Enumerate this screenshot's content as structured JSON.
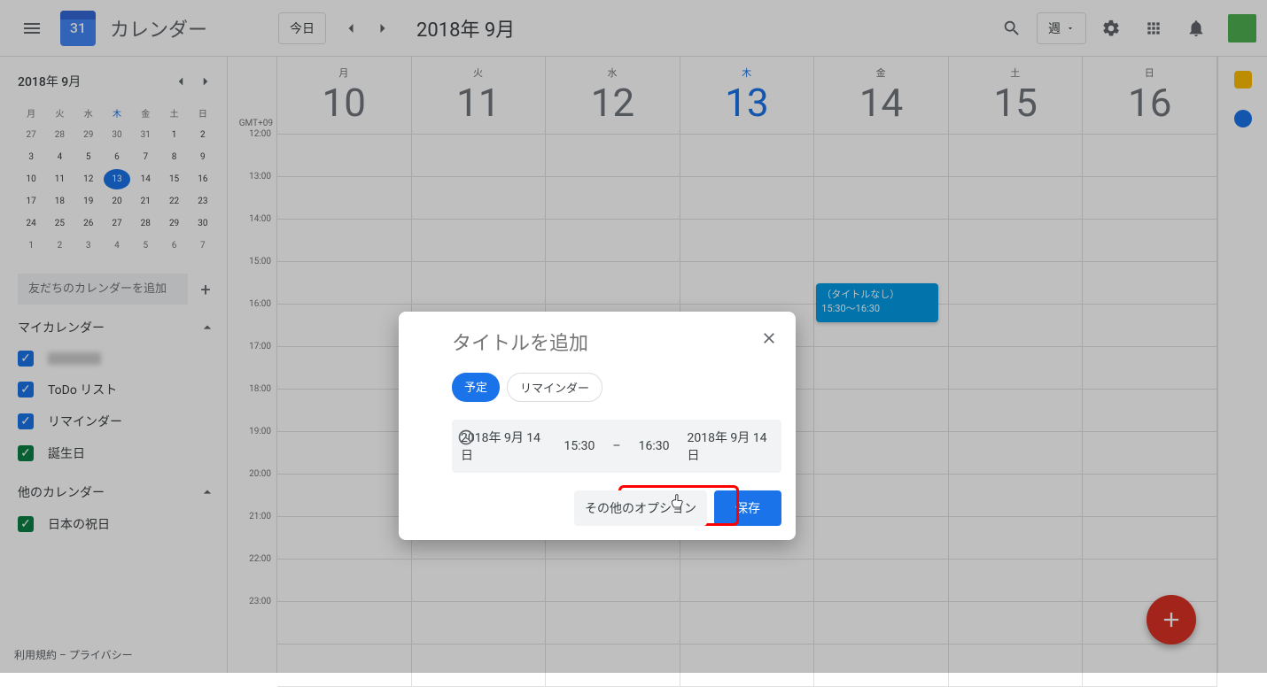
{
  "header": {
    "logo_day": "31",
    "app_title": "カレンダー",
    "today_button": "今日",
    "date_title": "2018年 9月",
    "view_label": "週"
  },
  "mini_calendar": {
    "title": "2018年 9月",
    "day_headers": [
      "月",
      "火",
      "水",
      "木",
      "金",
      "土",
      "日"
    ],
    "weeks": [
      [
        {
          "d": "27"
        },
        {
          "d": "28"
        },
        {
          "d": "29"
        },
        {
          "d": "30"
        },
        {
          "d": "31"
        },
        {
          "d": "1",
          "cur": true
        },
        {
          "d": "2",
          "cur": true
        }
      ],
      [
        {
          "d": "3",
          "cur": true
        },
        {
          "d": "4",
          "cur": true
        },
        {
          "d": "5",
          "cur": true
        },
        {
          "d": "6",
          "cur": true
        },
        {
          "d": "7",
          "cur": true
        },
        {
          "d": "8",
          "cur": true
        },
        {
          "d": "9",
          "cur": true
        }
      ],
      [
        {
          "d": "10",
          "cur": true
        },
        {
          "d": "11",
          "cur": true
        },
        {
          "d": "12",
          "cur": true
        },
        {
          "d": "13",
          "cur": true,
          "today": true
        },
        {
          "d": "14",
          "cur": true
        },
        {
          "d": "15",
          "cur": true
        },
        {
          "d": "16",
          "cur": true
        }
      ],
      [
        {
          "d": "17",
          "cur": true
        },
        {
          "d": "18",
          "cur": true
        },
        {
          "d": "19",
          "cur": true
        },
        {
          "d": "20",
          "cur": true
        },
        {
          "d": "21",
          "cur": true
        },
        {
          "d": "22",
          "cur": true
        },
        {
          "d": "23",
          "cur": true
        }
      ],
      [
        {
          "d": "24",
          "cur": true
        },
        {
          "d": "25",
          "cur": true
        },
        {
          "d": "26",
          "cur": true
        },
        {
          "d": "27",
          "cur": true
        },
        {
          "d": "28",
          "cur": true
        },
        {
          "d": "29",
          "cur": true
        },
        {
          "d": "30",
          "cur": true
        }
      ],
      [
        {
          "d": "1"
        },
        {
          "d": "2"
        },
        {
          "d": "3"
        },
        {
          "d": "4"
        },
        {
          "d": "5"
        },
        {
          "d": "6"
        },
        {
          "d": "7"
        }
      ]
    ]
  },
  "sidebar": {
    "add_friend_placeholder": "友だちのカレンダーを追加",
    "my_calendars_title": "マイカレンダー",
    "my_calendars": [
      {
        "label": "",
        "color": "#1a73e8",
        "blurred": true
      },
      {
        "label": "ToDo リスト",
        "color": "#1a73e8"
      },
      {
        "label": "リマインダー",
        "color": "#1a73e8"
      },
      {
        "label": "誕生日",
        "color": "#0b8043"
      }
    ],
    "other_calendars_title": "他のカレンダー",
    "other_calendars": [
      {
        "label": "日本の祝日",
        "color": "#0b8043"
      }
    ],
    "footer_terms": "利用規約",
    "footer_privacy": "プライバシー"
  },
  "week": {
    "timezone": "GMT+09",
    "days": [
      {
        "name": "月",
        "num": "10"
      },
      {
        "name": "火",
        "num": "11"
      },
      {
        "name": "水",
        "num": "12"
      },
      {
        "name": "木",
        "num": "13",
        "today": true
      },
      {
        "name": "金",
        "num": "14"
      },
      {
        "name": "土",
        "num": "15"
      },
      {
        "name": "日",
        "num": "16"
      }
    ],
    "hours": [
      "12:00",
      "13:00",
      "14:00",
      "15:00",
      "16:00",
      "17:00",
      "18:00",
      "19:00",
      "20:00",
      "21:00",
      "22:00",
      "23:00"
    ]
  },
  "event": {
    "title": "（タイトルなし）",
    "time": "15:30～16:30"
  },
  "dialog": {
    "title_placeholder": "タイトルを追加",
    "chip_event": "予定",
    "chip_reminder": "リマインダー",
    "date_start": "2018年 9月 14日",
    "time_start": "15:30",
    "time_sep": "–",
    "time_end": "16:30",
    "date_end": "2018年 9月 14日",
    "more_options": "その他のオプション",
    "save": "保存"
  }
}
